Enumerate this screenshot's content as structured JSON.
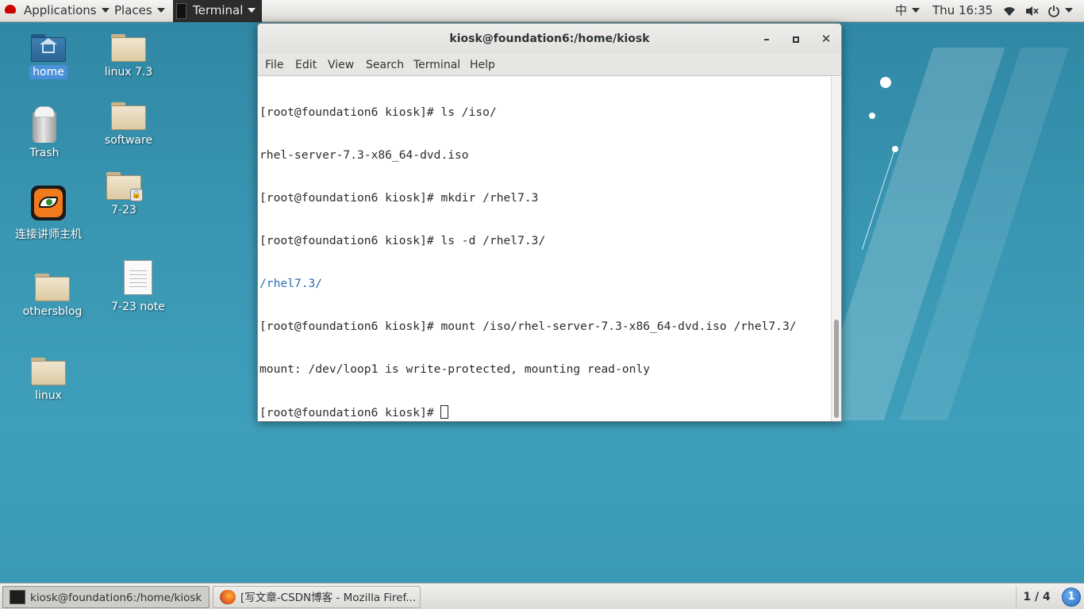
{
  "topbar": {
    "applications": "Applications",
    "places": "Places",
    "active_app": "Terminal",
    "input_method": "中",
    "clock": "Thu 16:35"
  },
  "desktop": {
    "icons": [
      {
        "label": "home",
        "selected": true,
        "kind": "home-folder"
      },
      {
        "label": "linux 7.3",
        "kind": "folder"
      },
      {
        "label": "Trash",
        "kind": "trash"
      },
      {
        "label": "software",
        "kind": "folder"
      },
      {
        "label": "7-23",
        "kind": "locked-folder"
      },
      {
        "label": "连接讲师主机",
        "kind": "app"
      },
      {
        "label": "othersblog",
        "kind": "folder"
      },
      {
        "label": "7-23 note",
        "kind": "text-file"
      },
      {
        "label": "linux",
        "kind": "folder"
      }
    ]
  },
  "terminal": {
    "title": "kiosk@foundation6:/home/kiosk",
    "menu": [
      "File",
      "Edit",
      "View",
      "Search",
      "Terminal",
      "Help"
    ],
    "lines": [
      "[root@foundation6 kiosk]# ls /iso/",
      "rhel-server-7.3-x86_64-dvd.iso",
      "[root@foundation6 kiosk]# mkdir /rhel7.3",
      "[root@foundation6 kiosk]# ls -d /rhel7.3/",
      "/rhel7.3/",
      "[root@foundation6 kiosk]# mount /iso/rhel-server-7.3-x86_64-dvd.iso /rhel7.3/",
      "mount: /dev/loop1 is write-protected, mounting read-only",
      "[root@foundation6 kiosk]# "
    ],
    "directory_color": "#2a6db0"
  },
  "taskbar": {
    "tasks": [
      {
        "label": "kiosk@foundation6:/home/kiosk",
        "active": true
      },
      {
        "label": "[写文章-CSDN博客 - Mozilla Firef...",
        "active": false
      }
    ],
    "workspace": "1 / 4",
    "notifications": "1"
  }
}
